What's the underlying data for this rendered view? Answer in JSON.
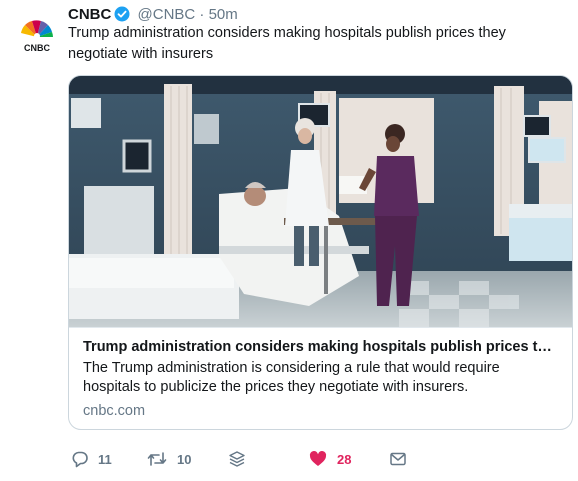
{
  "tweet": {
    "avatar_label": "CNBC",
    "display_name": "CNBC",
    "handle": "@CNBC",
    "separator": "·",
    "time": "50m",
    "text": "Trump administration considers making hospitals publish prices they negotiate with insurers",
    "card": {
      "title": "Trump administration considers making hospitals publish prices the...",
      "description": "The Trump administration is considering a rule that would require hospitals to publicize the prices they negotiate with insurers.",
      "domain": "cnbc.com",
      "image_icon": "hospital-room-photo"
    },
    "actions": {
      "reply_count": "11",
      "retweet_count": "10",
      "like_count": "28"
    },
    "colors": {
      "like": "#e0245e",
      "verified": "#1da1f2",
      "muted": "#657786"
    }
  }
}
